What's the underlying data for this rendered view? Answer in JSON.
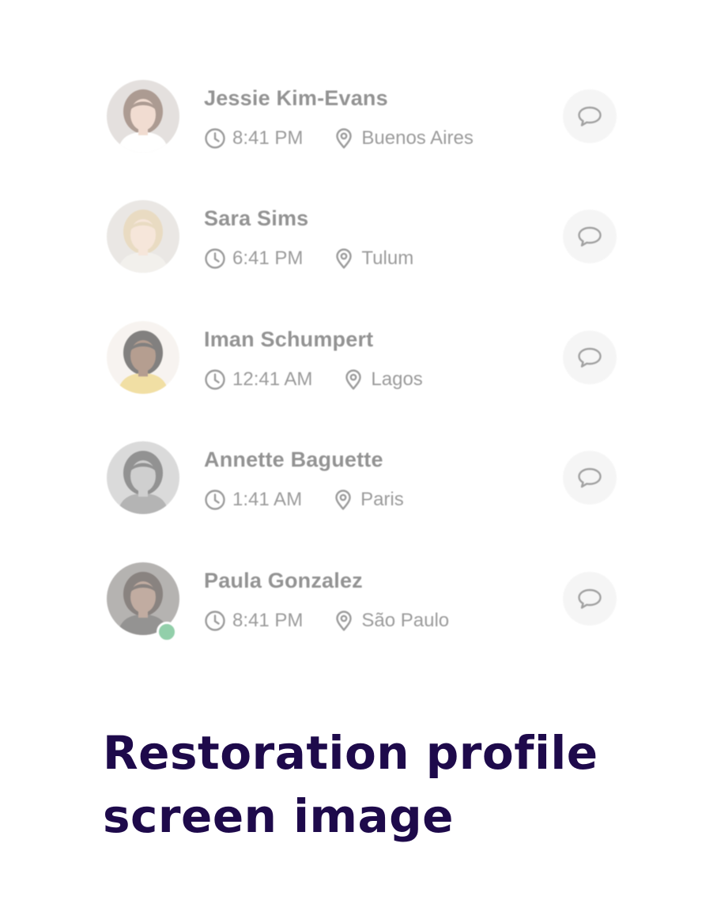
{
  "contacts": [
    {
      "name": "Jessie Kim-Evans",
      "time": "8:41 PM",
      "location": "Buenos Aires",
      "online": false,
      "avatar": {
        "bg": "#cfc8c4",
        "skin": "#e6c1ad",
        "hair": "#6a4a3a",
        "shirt": "#ffffff"
      }
    },
    {
      "name": "Sara Sims",
      "time": "6:41 PM",
      "location": "Tulum",
      "online": false,
      "avatar": {
        "bg": "#d9d5cf",
        "skin": "#efd2bd",
        "hair": "#d8bf92",
        "shirt": "#e8e4de"
      }
    },
    {
      "name": "Iman Schumpert",
      "time": "12:41 AM",
      "location": "Lagos",
      "online": false,
      "avatar": {
        "bg": "#f1ebe4",
        "skin": "#7a5037",
        "hair": "#1d1a18",
        "shirt": "#e7c55a"
      }
    },
    {
      "name": "Annette Baguette",
      "time": "1:41 AM",
      "location": "Paris",
      "online": false,
      "avatar": {
        "bg": "#bdbdbd",
        "skin": "#a9a9a9",
        "hair": "#3a3a3a",
        "shirt": "#777777"
      }
    },
    {
      "name": "Paula Gonzalez",
      "time": "8:41 PM",
      "location": "São Paulo",
      "online": true,
      "avatar": {
        "bg": "#7a7672",
        "skin": "#8f6a55",
        "hair": "#2a1e19",
        "shirt": "#3e3c3a"
      }
    }
  ],
  "caption": {
    "line1": "Restoration profile",
    "line2": "screen image"
  },
  "colors": {
    "caption": "#1e0a4b",
    "online_dot": "#3aa865",
    "chat_button_bg": "#eeeeee"
  }
}
